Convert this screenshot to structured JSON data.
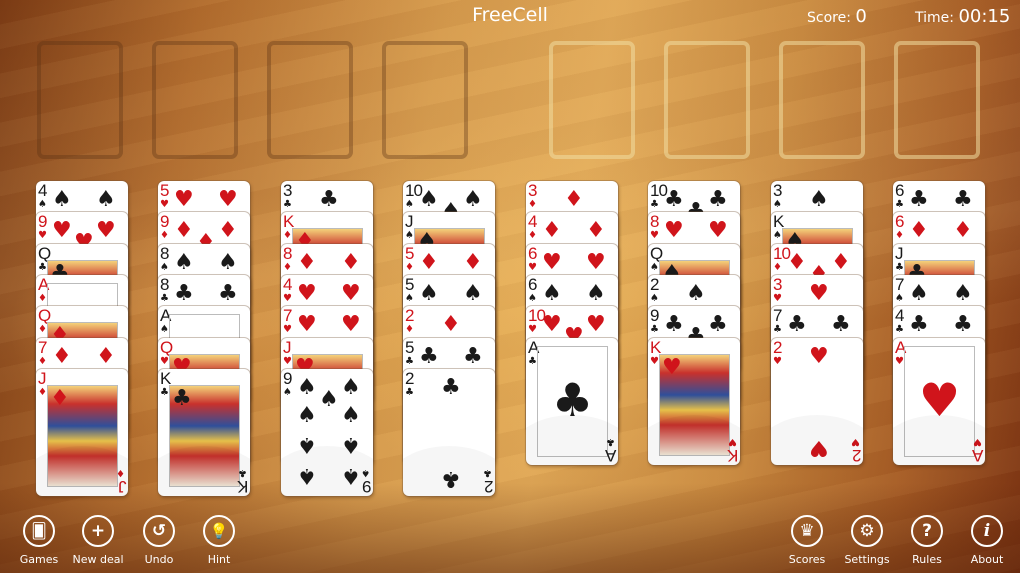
{
  "header": {
    "title": "FreeCell",
    "score_label": "Score:",
    "score_value": "0",
    "time_label": "Time:",
    "time_value": "00:15"
  },
  "free_cells": [
    null,
    null,
    null,
    null
  ],
  "foundations": [
    null,
    null,
    null,
    null
  ],
  "tableau": [
    [
      {
        "rank": "4",
        "suit": "spades"
      },
      {
        "rank": "9",
        "suit": "hearts"
      },
      {
        "rank": "Q",
        "suit": "clubs"
      },
      {
        "rank": "A",
        "suit": "diamonds"
      },
      {
        "rank": "Q",
        "suit": "diamonds"
      },
      {
        "rank": "7",
        "suit": "diamonds"
      },
      {
        "rank": "J",
        "suit": "diamonds"
      }
    ],
    [
      {
        "rank": "5",
        "suit": "hearts"
      },
      {
        "rank": "9",
        "suit": "diamonds"
      },
      {
        "rank": "8",
        "suit": "spades"
      },
      {
        "rank": "8",
        "suit": "clubs"
      },
      {
        "rank": "A",
        "suit": "spades"
      },
      {
        "rank": "Q",
        "suit": "hearts"
      },
      {
        "rank": "K",
        "suit": "clubs"
      }
    ],
    [
      {
        "rank": "3",
        "suit": "clubs"
      },
      {
        "rank": "K",
        "suit": "diamonds"
      },
      {
        "rank": "8",
        "suit": "diamonds"
      },
      {
        "rank": "4",
        "suit": "hearts"
      },
      {
        "rank": "7",
        "suit": "hearts"
      },
      {
        "rank": "J",
        "suit": "hearts"
      },
      {
        "rank": "9",
        "suit": "spades"
      }
    ],
    [
      {
        "rank": "10",
        "suit": "spades"
      },
      {
        "rank": "J",
        "suit": "spades"
      },
      {
        "rank": "5",
        "suit": "diamonds"
      },
      {
        "rank": "5",
        "suit": "spades"
      },
      {
        "rank": "2",
        "suit": "diamonds"
      },
      {
        "rank": "5",
        "suit": "clubs"
      },
      {
        "rank": "2",
        "suit": "clubs"
      }
    ],
    [
      {
        "rank": "3",
        "suit": "diamonds"
      },
      {
        "rank": "4",
        "suit": "diamonds"
      },
      {
        "rank": "6",
        "suit": "hearts"
      },
      {
        "rank": "6",
        "suit": "spades"
      },
      {
        "rank": "10",
        "suit": "hearts"
      },
      {
        "rank": "A",
        "suit": "clubs"
      }
    ],
    [
      {
        "rank": "10",
        "suit": "clubs"
      },
      {
        "rank": "8",
        "suit": "hearts"
      },
      {
        "rank": "Q",
        "suit": "spades"
      },
      {
        "rank": "2",
        "suit": "spades"
      },
      {
        "rank": "9",
        "suit": "clubs"
      },
      {
        "rank": "K",
        "suit": "hearts"
      }
    ],
    [
      {
        "rank": "3",
        "suit": "spades"
      },
      {
        "rank": "K",
        "suit": "spades"
      },
      {
        "rank": "10",
        "suit": "diamonds"
      },
      {
        "rank": "3",
        "suit": "hearts"
      },
      {
        "rank": "7",
        "suit": "clubs"
      },
      {
        "rank": "2",
        "suit": "hearts"
      }
    ],
    [
      {
        "rank": "6",
        "suit": "clubs"
      },
      {
        "rank": "6",
        "suit": "diamonds"
      },
      {
        "rank": "J",
        "suit": "clubs"
      },
      {
        "rank": "7",
        "suit": "spades"
      },
      {
        "rank": "4",
        "suit": "clubs"
      },
      {
        "rank": "A",
        "suit": "hearts"
      }
    ]
  ],
  "suit_glyphs": {
    "spades": "♠",
    "hearts": "♥",
    "diamonds": "♦",
    "clubs": "♣"
  },
  "colors": {
    "red": "#d0141b",
    "black": "#1a1a1a"
  },
  "toolbar_left": [
    {
      "label": "Games",
      "icon": "games-icon",
      "glyph": "🂠"
    },
    {
      "label": "New deal",
      "icon": "plus-icon",
      "glyph": "+"
    },
    {
      "label": "Undo",
      "icon": "undo-icon",
      "glyph": "↺"
    },
    {
      "label": "Hint",
      "icon": "lightbulb-icon",
      "glyph": "💡"
    }
  ],
  "toolbar_right": [
    {
      "label": "Scores",
      "icon": "crown-icon",
      "glyph": "♛"
    },
    {
      "label": "Settings",
      "icon": "gear-icon",
      "glyph": "⚙"
    },
    {
      "label": "Rules",
      "icon": "question-icon",
      "glyph": "?"
    },
    {
      "label": "About",
      "icon": "info-icon",
      "glyph": "i"
    }
  ]
}
